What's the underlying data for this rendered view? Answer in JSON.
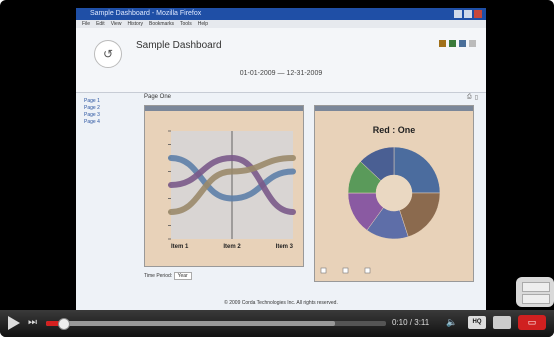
{
  "window": {
    "title": "Sample Dashboard - Mozilla Firefox"
  },
  "menu": [
    "File",
    "Edit",
    "View",
    "History",
    "Bookmarks",
    "Tools",
    "Help"
  ],
  "header": {
    "logo_glyph": "↺",
    "title": "Sample Dashboard",
    "date_range": "01-01-2009 — 12-31-2009"
  },
  "sidebar": [
    "Page 1",
    "Page 2",
    "Page 3",
    "Page 4"
  ],
  "panel": {
    "title": "Page One"
  },
  "chart1": {
    "chart_data": {
      "type": "line",
      "categories": [
        "Item 1",
        "Item 2",
        "Item 3"
      ],
      "series": [
        {
          "values": [
            10,
            7,
            9
          ]
        },
        {
          "values": [
            8,
            10,
            6
          ]
        },
        {
          "values": [
            6,
            9,
            10
          ]
        }
      ],
      "colors": [
        "#5d7fa9",
        "#7a5a8a",
        "#9a8a6a"
      ]
    },
    "yticks": [
      "",
      "",
      "",
      "",
      "",
      "",
      "",
      "",
      ""
    ]
  },
  "chart2": {
    "chart_data": {
      "type": "pie",
      "title": "Red : One",
      "slices": [
        {
          "value": 25,
          "color": "#4b6c9e"
        },
        {
          "value": 20,
          "color": "#8b6a4e"
        },
        {
          "value": 15,
          "color": "#5e6ea8"
        },
        {
          "value": 15,
          "color": "#8a5aa2"
        },
        {
          "value": 12,
          "color": "#5a9a5a"
        },
        {
          "value": 13,
          "color": "#4a5f93"
        }
      ]
    }
  },
  "period": {
    "label": "Time Period:",
    "value": "Year"
  },
  "footer": "© 2009 Corda Technologies Inc. All rights reserved.",
  "player": {
    "time": "0:10 / 3:11",
    "hq": "HQ",
    "progress": 0.05,
    "buffered": 0.85
  }
}
